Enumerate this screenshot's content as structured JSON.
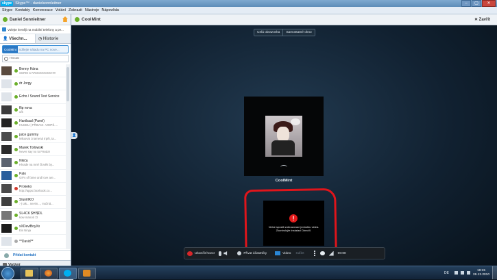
{
  "window": {
    "app_badge": "skype",
    "title": "Skype™ - danielsonnleitner",
    "buttons": [
      "–",
      "▢",
      "✕"
    ]
  },
  "menu": [
    "Skype",
    "Kontakty",
    "Konverzace",
    "Volání",
    "Zobrazit",
    "Nástroje",
    "Nápověda"
  ],
  "user": {
    "name": "Daniel Sonnleitner",
    "status_color": "#6bb02a"
  },
  "promo": "Volejte levněji na mobilní telefony a pe...",
  "tabs": {
    "all": "Všechn...",
    "history": "Historie"
  },
  "mood": {
    "name": "CoolMint",
    "text": "Sdílejte náladu na PC nove..."
  },
  "search": {
    "placeholder": "Hledat"
  },
  "contacts": [
    {
      "name": "Benny Hána",
      "mood": "SORM C'AROOOOOOO!!!!!",
      "status": "online"
    },
    {
      "name": "dr Jorgy",
      "mood": "",
      "status": "online"
    },
    {
      "name": "Echo / Sound Test Service",
      "mood": "",
      "status": "online"
    },
    {
      "name": "flip nova",
      "mood": "ufk",
      "status": "online"
    },
    {
      "name": "Hanibaal (Pavel)",
      "mood": "HUDBU | PŘ8VCII. VIMPŠ....",
      "status": "online"
    },
    {
      "name": "juice gummy",
      "mood": "Miluovat znamená trpět, ta...",
      "status": "online"
    },
    {
      "name": "Marek Toilowski",
      "mood": "Never say no to Panda!",
      "status": "online"
    },
    {
      "name": "Nikča",
      "mood": "Hlvade na mně člověk by...",
      "status": "online"
    },
    {
      "name": "Palo",
      "mood": "GIFs of fame and love are...",
      "status": "online"
    },
    {
      "name": "Prokeko",
      "mood": "http://apps.facebook.co...",
      "status": "busy"
    },
    {
      "name": "SluniÍIKO",
      "mood": ":-) tak... nevim..., možná...",
      "status": "online"
    },
    {
      "name": "SL4CK $H!$DL",
      "mood": "kow manoti :D",
      "status": "online"
    },
    {
      "name": "xXDeviBoyXx",
      "mood": "Eis Ninja",
      "status": "online"
    },
    {
      "name": "**David**",
      "mood": "",
      "status": "offline"
    }
  ],
  "add_contact": "Přidat kontakt",
  "calls": {
    "label": "Volání"
  },
  "online_count": "20 733 788 uživatelů online",
  "conversation": {
    "name": "CoolMint",
    "close": "Zavřít"
  },
  "view_buttons": [
    "Celá obrazovka",
    "Samostatné okno"
  ],
  "remote_name": "CoolMint",
  "local_error": "Nelze spustit zobrazovací jednotku videa. Zkontrolujte instalaci DirectX.",
  "toolbar": {
    "hangup": "Ukončit hovor",
    "add": "Přivat účastníky",
    "video": "Video",
    "share": "Sdílet",
    "timer": "00:00"
  },
  "taskbar": {
    "lang": "DE",
    "time": "18:15",
    "date": "26.12.2010"
  },
  "colors": {
    "annotation": "#e0151b",
    "accent": "#00aff0",
    "online": "#6bb02a",
    "busy": "#d43b2e"
  }
}
